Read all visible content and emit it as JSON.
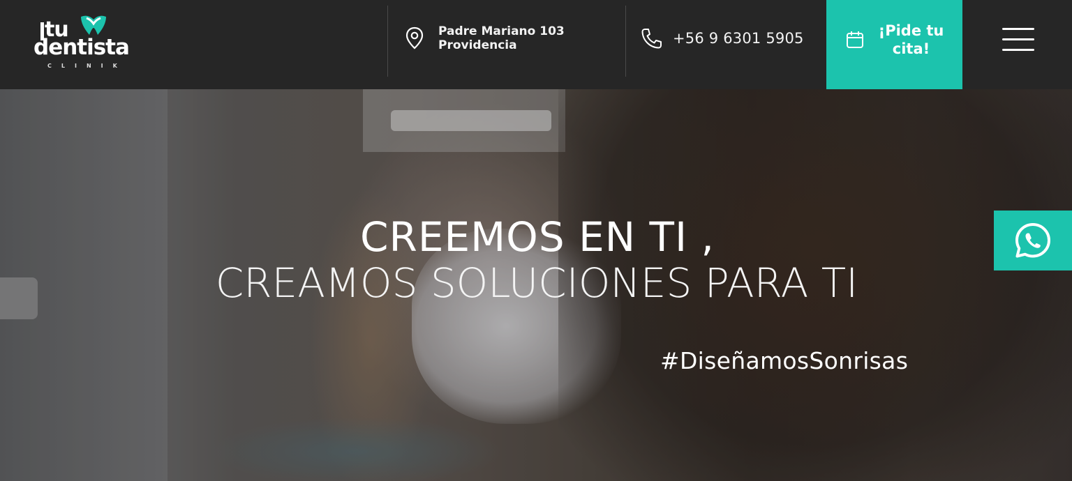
{
  "brand": {
    "logo_line1": "tu",
    "logo_line2": "dentista",
    "logo_line3": "CLINIK",
    "accent_color": "#1cc3ad"
  },
  "header": {
    "address_icon": "map-pin-icon",
    "address_line1": "Padre Mariano 103",
    "address_line2": "Providencia",
    "phone_icon": "phone-icon",
    "phone": "+56 9 6301 5905",
    "cta_icon": "calendar-icon",
    "cta_line1": "¡Pide tu",
    "cta_line2": "cita!",
    "menu_icon": "hamburger-menu-icon"
  },
  "hero": {
    "headline_line1": "CREEMOS EN TI ,",
    "headline_line2": "CREAMOS SOLUCIONES PARA TI",
    "hashtag": "#DiseñamosSonrisas"
  },
  "floating": {
    "whatsapp_icon": "whatsapp-icon"
  }
}
